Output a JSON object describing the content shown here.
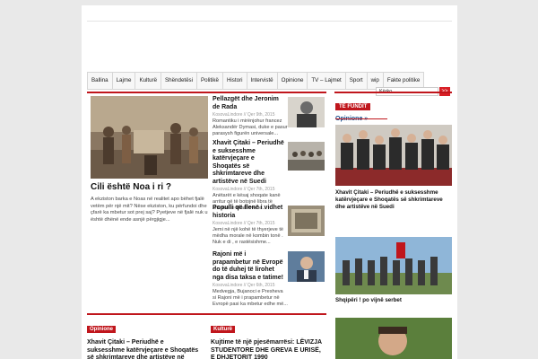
{
  "nav": [
    "Ballina",
    "Lajme",
    "Kulturë",
    "Shëndetësi",
    "Politikë",
    "Histori",
    "Intervistë",
    "Opinione",
    "TV – Lajmet",
    "Sport",
    "wip",
    "Fakte politike"
  ],
  "search": {
    "value": "Kërko...",
    "button": ">>"
  },
  "featured": {
    "title": "Cili është Noa i ri ?",
    "text": "A ekziston barka e Noas në realitet apo bëhet fjalë vetëm për një mit? Nëse ekziston, ku përfundoi dhe çfarë ka mbetur sot prej saj? Pyetjeve në fjalë nuk u është dhënë ende asnjë përgjigje..."
  },
  "articles": [
    {
      "title": "Pellazgët dhe Jeronim de Rada",
      "meta": "KosovaLindore // Qer 9th, 2015",
      "text": "Romantiku i mirënjohur francez Aleksandër Dymasi, duke e pasur parasysh figurën universale..."
    },
    {
      "title": "Xhavit Çitaki – Periudhë e suksesshme katërvjeçare e Shoqatës së shkrimtareve dhe artistëve në Suedi",
      "meta": "KosovaLindore // Qer 7th, 2015",
      "text": "Anëtarët e kësaj shoqate kanë arritur që të botojnë libra të shumtë të zhanreve të..."
    },
    {
      "title": "Populli që flenë i vidhet historia",
      "meta": "KosovaLindore // Qer 7th, 2015",
      "text": "Jemi në një kohë të thyerjeve të mëdha morale në kombin tonë . Nuk e di , e rastësishme..."
    },
    {
      "title": "Rajoni më i prapambetur në Evropë do të duhej të lirohet nga disa taksa e tatime!",
      "meta": "KosovaLindore // Qer 6th, 2015",
      "text": "Medvegja, Bujanoci e Presheva si Rajoni më i prapambetur në Evropë pasi ka mbetur edhe më..."
    }
  ],
  "right": {
    "label": "TË FUNDIT",
    "heading": "Opinione »",
    "caption1": "Xhavit Çitaki – Periudhë e suksesshme katërvjeçare e Shoqatës së shkrimtareve dhe artistëve në Suedi",
    "caption2": "Shqipëri ! po vijnë serbet"
  },
  "bottom": [
    {
      "tag": "Opinione",
      "title": "Xhavit Çitaki – Periudhë e suksesshme katërvjeçare e Shoqatës së shkrimtareve dhe artistëve në"
    },
    {
      "tag": "Kulturë",
      "title": "Kujtime të një pjesëmarrësi: LËVIZJA STUDENTORE DHE GREVA E URISË, E DHJETORIT 1990"
    }
  ],
  "colors": {
    "accent": "#c0161c",
    "link": "#1c4f8c"
  }
}
